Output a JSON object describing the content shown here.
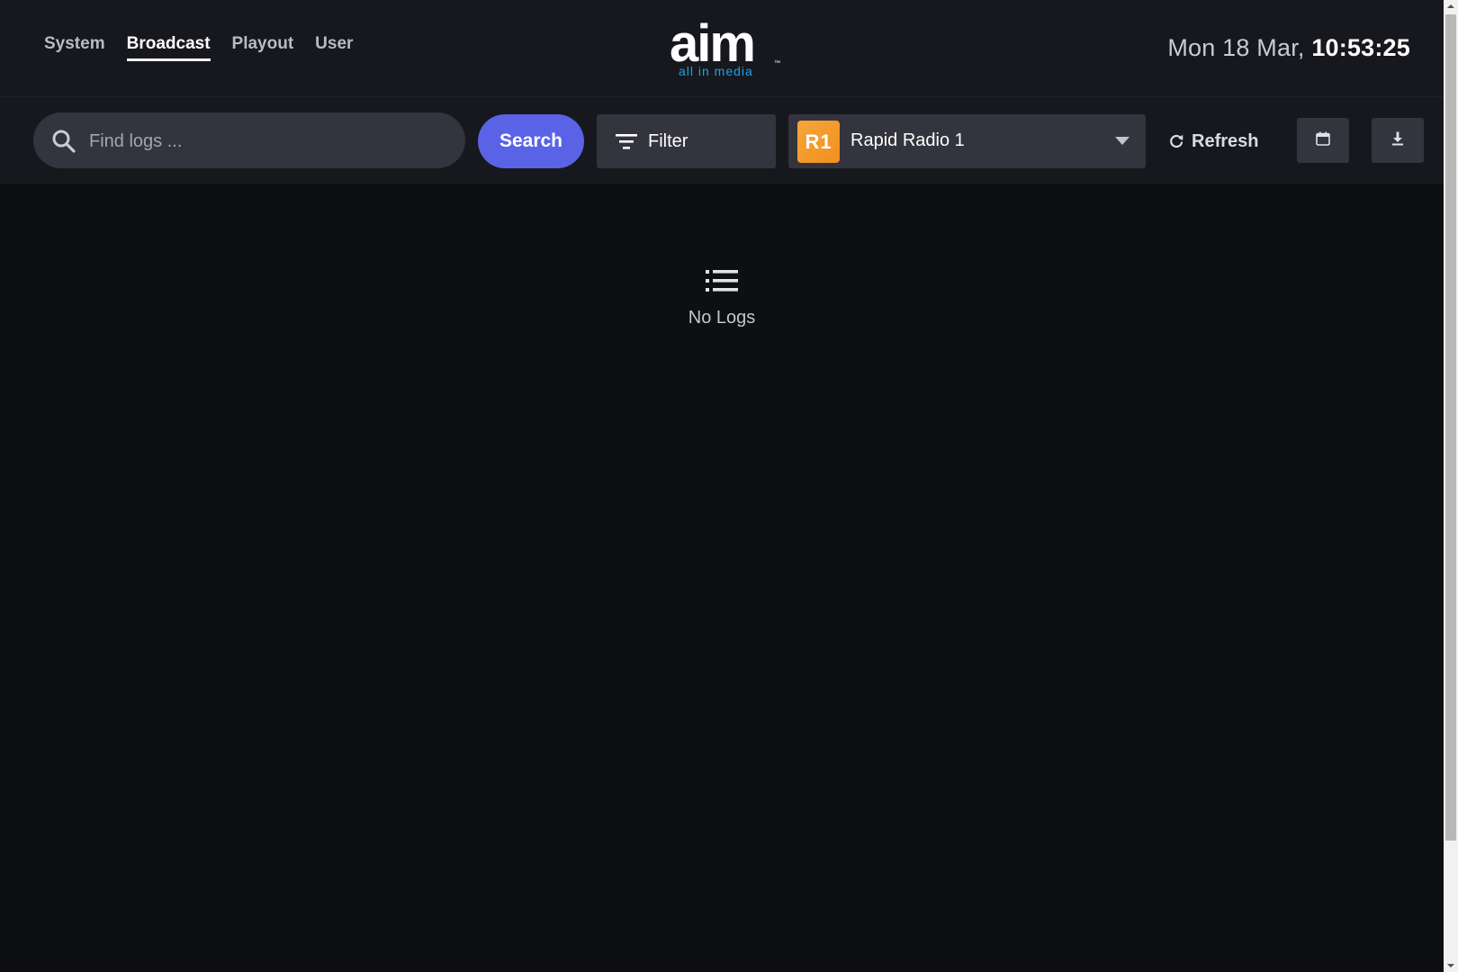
{
  "nav": {
    "items": [
      {
        "label": "System",
        "active": false
      },
      {
        "label": "Broadcast",
        "active": true
      },
      {
        "label": "Playout",
        "active": false
      },
      {
        "label": "User",
        "active": false
      }
    ]
  },
  "logo": {
    "wordmark": "aim",
    "tagline": "all in media",
    "trademark": "™"
  },
  "clock": {
    "date": "Mon 18 Mar,",
    "time": "10:53:25"
  },
  "toolbar": {
    "search_placeholder": "Find logs ...",
    "search_label": "Search",
    "filter_label": "Filter",
    "station": {
      "badge": "R1",
      "name": "Rapid Radio 1"
    },
    "refresh_label": "Refresh"
  },
  "main": {
    "empty_text": "No Logs"
  },
  "colors": {
    "accent": "#5a63e6",
    "station_badge": "#f7a63a",
    "header_bg": "#17181d",
    "page_bg": "#0e0f12",
    "control_bg": "#33343d",
    "logo_tagline": "#1aa3e8"
  },
  "icons": {
    "search": "search-icon",
    "filter": "filter-icon",
    "dropdown": "chevron-down-icon",
    "refresh": "refresh-icon",
    "calendar": "calendar-icon",
    "download": "download-icon",
    "empty": "list-icon"
  }
}
